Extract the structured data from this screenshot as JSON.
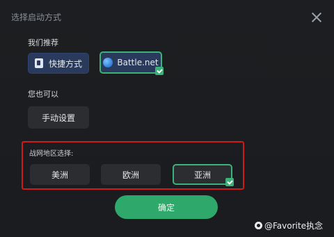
{
  "dialog": {
    "title": "选择启动方式",
    "recommended_label": "我们推荐",
    "also_label": "您也可以",
    "region_label": "战网地区选择:",
    "confirm_label": "确定"
  },
  "buttons": {
    "shortcut_label": "快捷方式",
    "battlenet_label": "Battle.net",
    "manual_label": "手动设置"
  },
  "regions": {
    "americas": "美洲",
    "europe": "欧洲",
    "asia": "亚洲",
    "selected": "亚洲"
  },
  "colors": {
    "accent_green": "#3bb27a",
    "highlight_red": "#d11a1a",
    "confirm_green": "#2ea86b"
  },
  "watermark": {
    "text": "@Favorite执念"
  },
  "icons": {
    "close": "close-icon",
    "shortcut": "shortcut-icon",
    "battlenet": "battlenet-icon",
    "check": "check-icon"
  }
}
